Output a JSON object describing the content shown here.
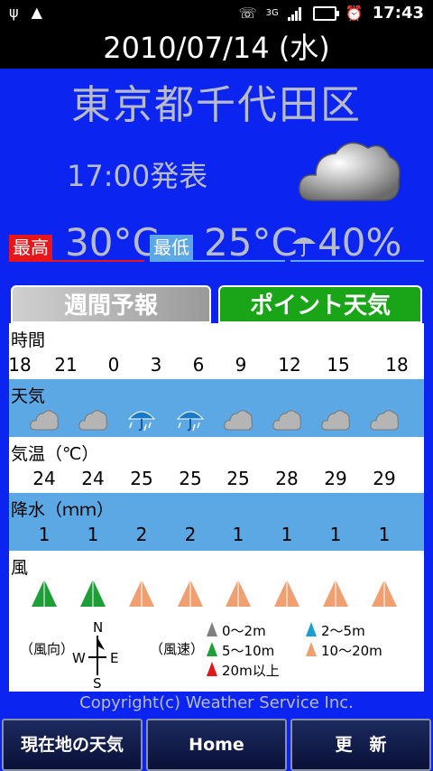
{
  "status_bar": {
    "time": "17:43",
    "network": "3G"
  },
  "date": "2010/07/14 (水)",
  "location": "東京都千代田区",
  "issued": "17:00発表",
  "forecast": {
    "max_label": "最高",
    "max_temp": "30°C",
    "min_label": "最低",
    "min_temp": "25°C",
    "rain": "40%"
  },
  "tabs": {
    "weekly": "週間予報",
    "point": "ポイント天気"
  },
  "table": {
    "time_label": "時間",
    "times": [
      "18",
      "21",
      "0",
      "3",
      "6",
      "9",
      "12",
      "15",
      "18"
    ],
    "weather_label": "天気",
    "weather": [
      "cloud",
      "cloud",
      "rain",
      "rain",
      "cloud",
      "cloud",
      "cloud",
      "cloud"
    ],
    "temp_label": "気温（℃）",
    "temps": [
      "24",
      "24",
      "25",
      "25",
      "25",
      "28",
      "29",
      "29"
    ],
    "precip_label": "降水（ｍｍ）",
    "precip": [
      "1",
      "1",
      "2",
      "2",
      "1",
      "1",
      "1",
      "1"
    ],
    "wind_label": "風",
    "wind_speed_class": [
      "5～10m",
      "5～10m",
      "10～20m",
      "10～20m",
      "10～20m",
      "10～20m",
      "10～20m",
      "10～20m"
    ]
  },
  "legend": {
    "direction_label": "（風向）",
    "speed_label": "（風速）",
    "compass": {
      "n": "N",
      "s": "S",
      "e": "E",
      "w": "W"
    },
    "items": [
      {
        "label": "0～2m",
        "color": "#808080"
      },
      {
        "label": "2～5m",
        "color": "#1a9fd0"
      },
      {
        "label": "5～10m",
        "color": "#1e9e36"
      },
      {
        "label": "10～20m",
        "color": "#f0a070"
      },
      {
        "label": "20m以上",
        "color": "#e01818"
      }
    ]
  },
  "copyright": "Copyright(c) Weather Service Inc.",
  "buttons": {
    "current": "現在地の天気",
    "home": "Home",
    "update": "更　新"
  },
  "colors": {
    "background": "#0b24f0",
    "row_blue": "#5ba8e4",
    "max": "#e8151b",
    "tab_active": "#1aa418"
  }
}
